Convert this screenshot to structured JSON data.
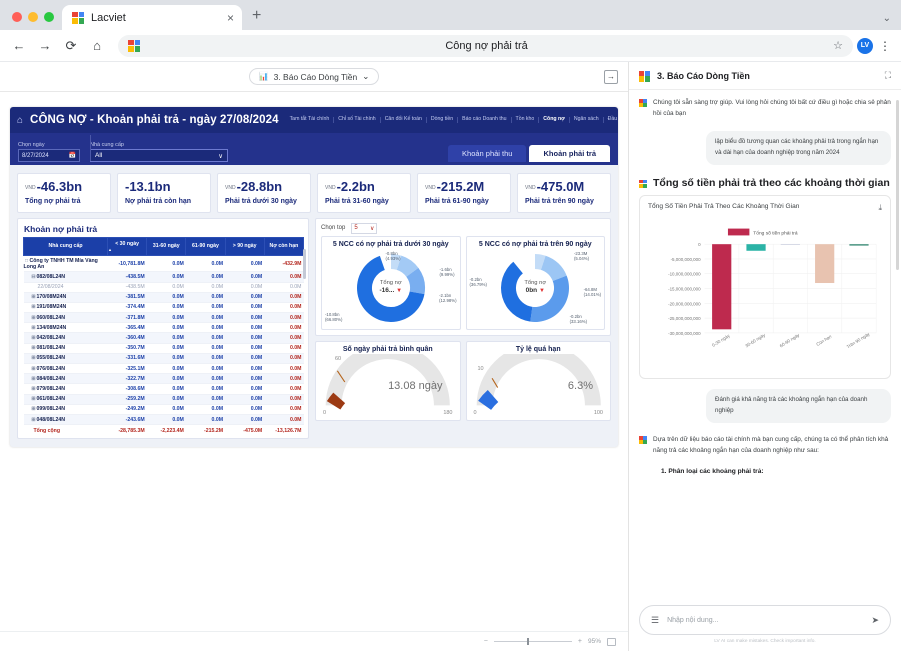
{
  "browser": {
    "tab_title": "Lacviet",
    "tab_close": "×",
    "new_tab": "+",
    "tabstrip_menu": "⌄",
    "back": "←",
    "forward": "→",
    "reload": "⟳",
    "home": "⌂",
    "omnibox_title": "Công nợ phải trả",
    "star": "☆",
    "profile_initials": "LV",
    "kebab": "⋮"
  },
  "report_toolbar": {
    "breadcrumb_icon": "report-icon",
    "breadcrumb": "3. Báo Cáo Dòng Tiền",
    "breadcrumb_caret": "⌄",
    "panel_toggle_icon": "→"
  },
  "dashboard": {
    "home_icon": "⌂",
    "title": "CÔNG NỢ - Khoản phải trả - ngày 27/08/2024",
    "nav": [
      {
        "label": "Tam tắt Tài chính",
        "active": false
      },
      {
        "label": "Chỉ số Tài chính",
        "active": false
      },
      {
        "label": "Cân đối Kế toán",
        "active": false
      },
      {
        "label": "Dòng tiền",
        "active": false
      },
      {
        "label": "Báo cáo Doanh thu",
        "active": false
      },
      {
        "label": "Tồn kho",
        "active": false
      },
      {
        "label": "Công nợ",
        "active": true
      },
      {
        "label": "Ngân sách",
        "active": false
      },
      {
        "label": "Đầu tư",
        "active": false
      }
    ],
    "filters": {
      "date_label": "Chọn ngày",
      "date_value": "8/27/2024",
      "date_icon": "🗓",
      "supplier_label": "Nhà cung cấp",
      "supplier_value": "All",
      "supplier_caret": "∨"
    },
    "tabs": [
      {
        "label": "Khoản phải thu",
        "active": false
      },
      {
        "label": "Khoản phải trả",
        "active": true
      }
    ],
    "kpis": [
      {
        "currency": "VND",
        "value": "-46.3bn",
        "label": "Tổng nợ phải trả"
      },
      {
        "currency": "",
        "value": "-13.1bn",
        "label": "Nợ phải trả còn hạn"
      },
      {
        "currency": "VND",
        "value": "-28.8bn",
        "label": "Phải trả dưới 30 ngày"
      },
      {
        "currency": "VND",
        "value": "-2.2bn",
        "label": "Phải trả 31-60 ngày"
      },
      {
        "currency": "VND",
        "value": "-215.2M",
        "label": "Phải trả 61-90 ngày"
      },
      {
        "currency": "VND",
        "value": "-475.0M",
        "label": "Phải trả trên 90 ngày"
      }
    ],
    "table": {
      "title": "Khoản nợ phải trả",
      "columns": [
        "Nhà cung cấp",
        "< 30 ngày",
        "31-60 ngày",
        "61-90 ngày",
        "> 90 ngày",
        "Nợ còn hạn"
      ],
      "sort_indicator": "▴",
      "rows": [
        {
          "toggle": "□",
          "name": "Công ty TNHH TM Mía Vàng Long An",
          "v": [
            "-10,781.8M",
            "0.0M",
            "0.0M",
            "0.0M",
            "-432.9M"
          ],
          "type": "group"
        },
        {
          "toggle": "⊟",
          "name": "082/08L24N",
          "v": [
            "-438.5M",
            "0.0M",
            "0.0M",
            "0.0M",
            "0.0M"
          ],
          "type": "item"
        },
        {
          "toggle": "",
          "name": "22/08/2024",
          "v": [
            "-438.5M",
            "0.0M",
            "0.0M",
            "0.0M",
            "0.0M"
          ],
          "type": "sub"
        },
        {
          "toggle": "⊞",
          "name": "170/08M24N",
          "v": [
            "-381.5M",
            "0.0M",
            "0.0M",
            "0.0M",
            "0.0M"
          ],
          "type": "item"
        },
        {
          "toggle": "⊞",
          "name": "191/08M24N",
          "v": [
            "-374.4M",
            "0.0M",
            "0.0M",
            "0.0M",
            "0.0M"
          ],
          "type": "item"
        },
        {
          "toggle": "⊞",
          "name": "060/08L24N",
          "v": [
            "-371.8M",
            "0.0M",
            "0.0M",
            "0.0M",
            "0.0M"
          ],
          "type": "item"
        },
        {
          "toggle": "⊞",
          "name": "134/08M24N",
          "v": [
            "-365.4M",
            "0.0M",
            "0.0M",
            "0.0M",
            "0.0M"
          ],
          "type": "item"
        },
        {
          "toggle": "⊞",
          "name": "042/08L24N",
          "v": [
            "-360.4M",
            "0.0M",
            "0.0M",
            "0.0M",
            "0.0M"
          ],
          "type": "item"
        },
        {
          "toggle": "⊞",
          "name": "081/08L24N",
          "v": [
            "-350.7M",
            "0.0M",
            "0.0M",
            "0.0M",
            "0.0M"
          ],
          "type": "item"
        },
        {
          "toggle": "⊞",
          "name": "055/08L24N",
          "v": [
            "-331.6M",
            "0.0M",
            "0.0M",
            "0.0M",
            "0.0M"
          ],
          "type": "item"
        },
        {
          "toggle": "⊞",
          "name": "076/08L24N",
          "v": [
            "-325.1M",
            "0.0M",
            "0.0M",
            "0.0M",
            "0.0M"
          ],
          "type": "item"
        },
        {
          "toggle": "⊞",
          "name": "084/08L24N",
          "v": [
            "-322.7M",
            "0.0M",
            "0.0M",
            "0.0M",
            "0.0M"
          ],
          "type": "item"
        },
        {
          "toggle": "⊞",
          "name": "079/08L24N",
          "v": [
            "-308.6M",
            "0.0M",
            "0.0M",
            "0.0M",
            "0.0M"
          ],
          "type": "item"
        },
        {
          "toggle": "⊞",
          "name": "061/08L24N",
          "v": [
            "-259.2M",
            "0.0M",
            "0.0M",
            "0.0M",
            "0.0M"
          ],
          "type": "item"
        },
        {
          "toggle": "⊞",
          "name": "099/08L24N",
          "v": [
            "-249.2M",
            "0.0M",
            "0.0M",
            "0.0M",
            "0.0M"
          ],
          "type": "item"
        },
        {
          "toggle": "⊞",
          "name": "048/08L24N",
          "v": [
            "-243.6M",
            "0.0M",
            "0.0M",
            "0.0M",
            "0.0M"
          ],
          "type": "item"
        }
      ],
      "total": {
        "name": "Tổng cộng",
        "v": [
          "-28,785.3M",
          "-2,223.4M",
          "-215.2M",
          "-475.0M",
          "-13,126.7M"
        ]
      }
    },
    "top_selector": {
      "label": "Chọn top",
      "value": "5",
      "caret": "∨"
    },
    "gauges": [
      {
        "title": "Số ngày phải trả bình quân",
        "value": "13.08 ngày",
        "min": "0",
        "max": "180",
        "target": "60",
        "color": "#9c3a13"
      },
      {
        "title": "Tỷ lệ quá hạn",
        "value": "6.3%",
        "min": "0",
        "max": "100",
        "target": "10",
        "color": "#2b6fe0"
      }
    ]
  },
  "chart_data": [
    {
      "type": "pie",
      "name": "donut-under-30",
      "title": "5 NCC có nợ phải trả dưới 30 ngày",
      "center_label": "Tổng nợ",
      "center_value": "-16...",
      "center_caret": "▼",
      "legend_position": "callout",
      "slices": [
        {
          "label": "-0.8bn",
          "percent_text": "(4.93%)",
          "percent": 4.93,
          "color": "#c3dcf7"
        },
        {
          "label": "-1.6bn",
          "percent_text": "(9.99%)",
          "percent": 9.99,
          "color": "#a3caf5"
        },
        {
          "label": "-2.1bn",
          "percent_text": "(12.98%)",
          "percent": 12.98,
          "color": "#79aef0"
        },
        {
          "label": "-10.8bn",
          "percent_text": "(66.80%)",
          "percent": 66.8,
          "color": "#1f6fe0"
        }
      ]
    },
    {
      "type": "pie",
      "name": "donut-over-90",
      "title": "5 NCC có nợ phải trả trên 90 ngày",
      "center_label": "Tổng nợ",
      "center_value": "0bn",
      "center_caret": "▼",
      "legend_position": "callout",
      "slices": [
        {
          "label": "-23.3M",
          "percent_text": "(5.04%)",
          "percent": 5.04,
          "color": "#c3dcf7"
        },
        {
          "label": "-64.8M",
          "percent_text": "(14.01%)",
          "percent": 14.01,
          "color": "#9cc6f4"
        },
        {
          "label": "-0.2bn",
          "percent_text": "(33.16%)",
          "percent": 33.16,
          "color": "#5b9bec"
        },
        {
          "label": "-0.2bn",
          "percent_text": "(36.79%)",
          "percent": 36.79,
          "color": "#1f6fe0"
        }
      ]
    },
    {
      "type": "bar",
      "name": "ai-bar-chart",
      "title": "Tổng Số Tiền Phải Trả Theo Các Khoảng Thời Gian",
      "legend": [
        "Tổng số tiền phải trả"
      ],
      "categories": [
        "0-30 ngày",
        "30-60 ngày",
        "60-90 ngày",
        "Còn hạn",
        "Trên 90 ngày"
      ],
      "values": [
        -28785300000,
        -2223400000,
        -215200000,
        -13126700000,
        -475000000
      ],
      "bar_colors": [
        "#be2a4e",
        "#2bb3a6",
        "#c5c9dd",
        "#e8c3b0",
        "#3f8f7a"
      ],
      "ytick_labels": [
        "0",
        "-5,000,000,000",
        "-10,000,000,000",
        "-15,000,000,000",
        "-20,000,000,000",
        "-25,000,000,000",
        "-30,000,000,000"
      ],
      "ylim": [
        -30000000000,
        0
      ],
      "xlabel": "",
      "ylabel": "",
      "grid": true,
      "download_icon": "⤓"
    }
  ],
  "ai_panel": {
    "title": "3. Báo Cáo Dòng Tiền",
    "expand_icon": "⛶",
    "greeting": "Chúng tôi sẵn sàng trợ giúp. Vui lòng hỏi chúng tôi bất cứ điều gì hoặc chia sẻ phản hồi của bạn",
    "user_msg_1": "lập biểu đồ tương quan các khoảng phải trả trong ngắn hạn và dài hạn của doanh nghiệp trong năm 2024",
    "section_title": "Tổng số tiền phải trả theo các khoảng thời gian",
    "user_msg_2": "Đánh giá khả năng trả các khoảng ngắn hạn của doanh nghiệp",
    "bot_msg_2": "Dựa trên dữ liệu báo cáo tài chính mà bạn cung cấp, chúng ta có thể phân tích khả năng trả các khoảng ngắn hạn của doanh nghiệp như sau:",
    "list_item_1": "1. Phân loại các khoảng phải trả:",
    "input_placeholder": "Nhập nội dung...",
    "menu_icon": "☰",
    "send_icon": "➤",
    "disclaimer": "LV AI can make mistakes. Check important info."
  },
  "page_footer": {
    "zoom_out": "−",
    "zoom_in": "+",
    "zoom_level": "95%",
    "fit_icon": "fit-to-page-icon"
  }
}
